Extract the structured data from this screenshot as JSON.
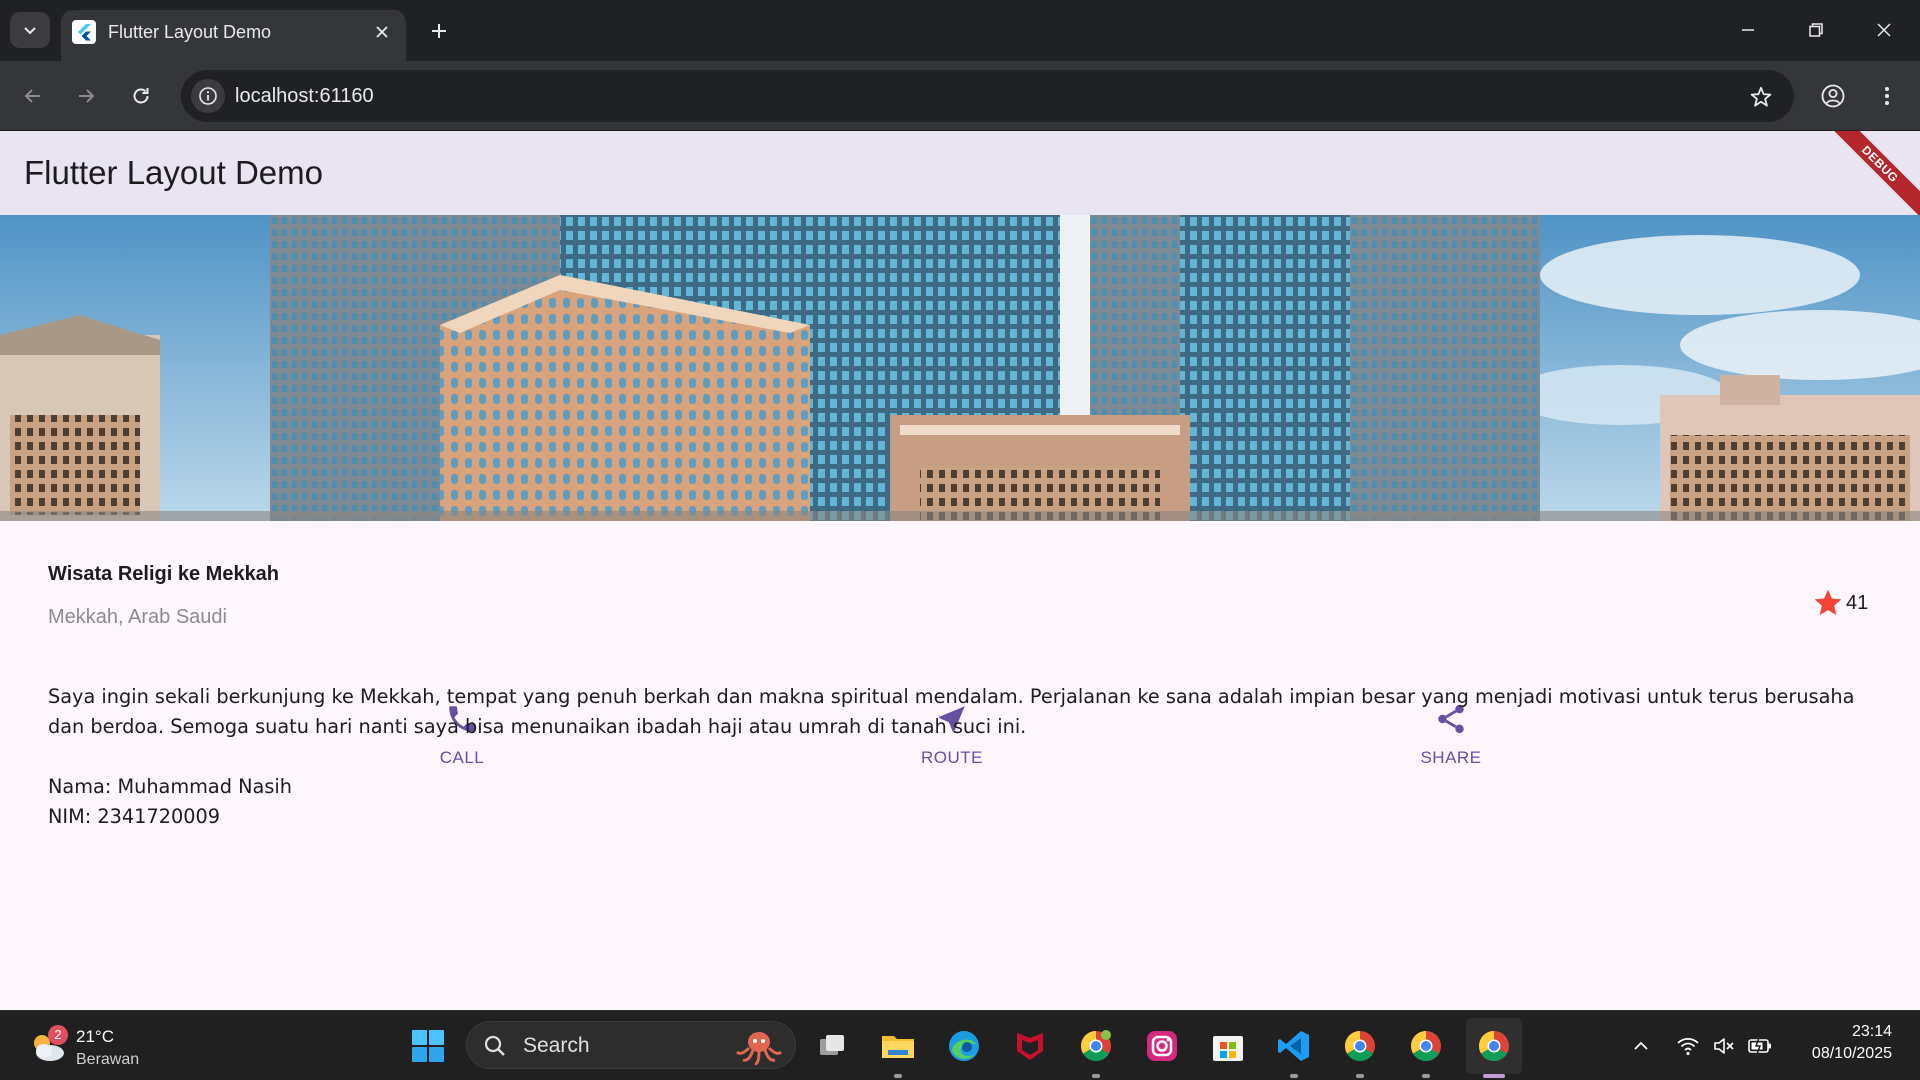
{
  "browser": {
    "tab_title": "Flutter Layout Demo",
    "url": "localhost:61160"
  },
  "app": {
    "appbar_title": "Flutter Layout Demo",
    "debug_banner": "DEBUG",
    "place": {
      "name": "Wisata Religi ke Mekkah",
      "location": "Mekkah, Arab Saudi",
      "rating_count": "41",
      "rating_icon": "star-icon",
      "rating_color": "#f44336"
    },
    "actions": [
      {
        "label": "CALL",
        "icon": "phone-icon"
      },
      {
        "label": "ROUTE",
        "icon": "navigation-icon"
      },
      {
        "label": "SHARE",
        "icon": "share-icon"
      }
    ],
    "accent_color": "#6750a4",
    "description": {
      "line1": "Saya ingin sekali berkunjung ke Mekkah, tempat yang penuh berkah dan makna spiritual mendalam. Perjalanan ke sana adalah impian besar yang menjadi motivasi untuk terus berusaha",
      "line2": "dan berdoa. Semoga suatu hari nanti saya bisa menunaikan ibadah haji atau umrah di tanah suci ini.",
      "name_line": "Nama: Muhammad Nasih",
      "nim_line": "NIM: 2341720009"
    }
  },
  "taskbar": {
    "weather": {
      "badge": "2",
      "temperature": "21°C",
      "condition": "Berawan"
    },
    "search_placeholder": "Search",
    "clock": {
      "time": "23:14",
      "date": "08/10/2025"
    }
  }
}
